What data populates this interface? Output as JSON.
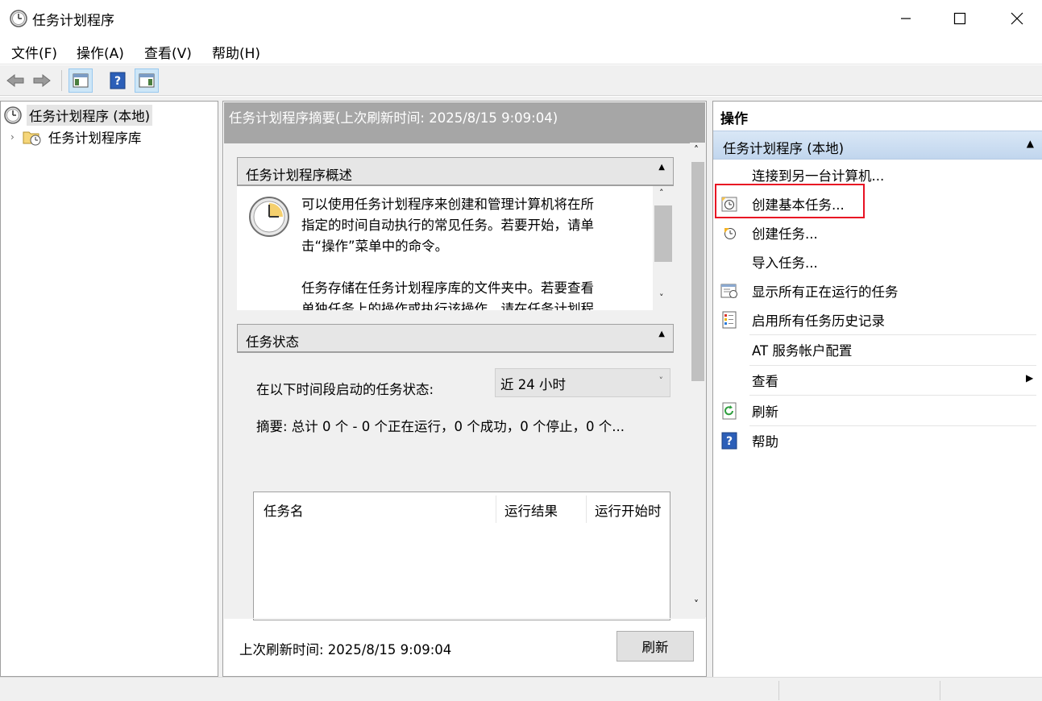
{
  "window": {
    "title": "任务计划程序"
  },
  "menu": [
    "文件(F)",
    "操作(A)",
    "查看(V)",
    "帮助(H)"
  ],
  "tree": {
    "root_label": "任务计划程序 (本地)",
    "child_label": "任务计划程序库"
  },
  "center": {
    "header": "任务计划程序摘要(上次刷新时间: 2025/8/15 9:09:04)",
    "overview_title": "任务计划程序概述",
    "overview_p1": [
      "可以使用任务计划程序来创建和管理计算机将在所",
      "指定的时间自动执行的常见任务。若要开始，请单",
      "击“操作”菜单中的命令。"
    ],
    "overview_p2": [
      "任务存储在任务计划程序库的文件夹中。若要查看",
      "单独任务上的操作或执行该操作，请在任务计划程"
    ],
    "status_title": "任务状态",
    "status_label": "在以下时间段启动的任务状态:",
    "status_select": "近 24 小时",
    "summary": "摘要: 总计 0 个 - 0 个正在运行，0 个成功，0 个停止，0 个...",
    "table_columns": [
      "任务名",
      "运行结果",
      "运行开始时"
    ],
    "footer_time": "上次刷新时间: 2025/8/15 9:09:04",
    "refresh_button": "刷新"
  },
  "actions": {
    "title": "操作",
    "subheader": "任务计划程序 (本地)",
    "items": [
      {
        "label": "连接到另一台计算机...",
        "icon": "none"
      },
      {
        "label": "创建基本任务...",
        "icon": "basic-task-icon"
      },
      {
        "label": "创建任务...",
        "icon": "create-task-icon"
      },
      {
        "label": "导入任务...",
        "icon": "none"
      },
      {
        "label": "显示所有正在运行的任务",
        "icon": "running-tasks-icon"
      },
      {
        "label": "启用所有任务历史记录",
        "icon": "history-icon"
      },
      {
        "label": "AT 服务帐户配置",
        "icon": "none"
      },
      {
        "label": "查看",
        "icon": "none"
      },
      {
        "label": "刷新",
        "icon": "refresh-icon"
      },
      {
        "label": "帮助",
        "icon": "help-icon"
      }
    ],
    "highlight_color": "#e81123"
  }
}
